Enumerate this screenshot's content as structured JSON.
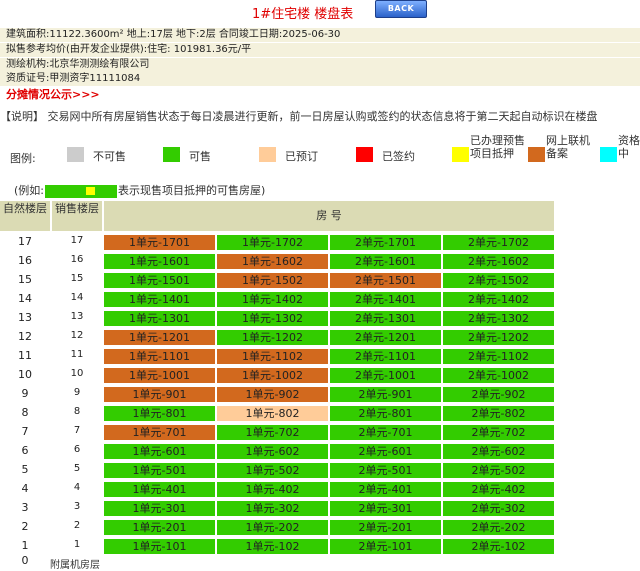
{
  "header": {
    "title": "1#住宅楼  楼盘表",
    "back_label": "BACK"
  },
  "info": {
    "line1": "建筑面积:11122.3600m²   地上:17层   地下:2层   合同竣工日期:2025-06-30",
    "line2": "拟售参考均价(由开发企业提供):住宅:  101981.36元/平",
    "line3": "测绘机构:北京华测测绘有限公司",
    "line4": "资质证号:甲测资字11111084"
  },
  "share_link": "分摊情况公示>>>",
  "notice": "【说明】 交易网中所有房屋销售状态于每日凌晨进行更新，前一日房屋认购或签约的状态信息将于第二天起自动标识在楼盘",
  "legend": {
    "label": "图例:",
    "items": [
      {
        "label": "不可售",
        "color": "#cccccc"
      },
      {
        "label": "可售",
        "color": "#33cc00"
      },
      {
        "label": "已预订",
        "color": "#ffcc99"
      },
      {
        "label": "已签约",
        "color": "#ff0000"
      },
      {
        "label": "已办理预售项目抵押",
        "color": "#ffff00"
      },
      {
        "label": "网上联机备案",
        "color": "#d2691e"
      },
      {
        "label": "资格中",
        "color": "#00ffff"
      }
    ]
  },
  "example": {
    "prefix": "(例如:",
    "suffix": "表示现售项目抵押的可售房屋)"
  },
  "table": {
    "col_natural": "自然楼层",
    "col_sales": "销售楼层",
    "col_room": "房  号",
    "status_colors": {
      "ok": "#33cc00",
      "mortgage": "#d2691e",
      "reserved": "#ffcc99"
    },
    "rows": [
      {
        "natural": "17",
        "sales": "17",
        "units": [
          {
            "label": "1单元-1701",
            "status": "mortgage"
          },
          {
            "label": "1单元-1702",
            "status": "ok"
          },
          {
            "label": "2单元-1701",
            "status": "ok"
          },
          {
            "label": "2单元-1702",
            "status": "ok"
          }
        ]
      },
      {
        "natural": "16",
        "sales": "16",
        "units": [
          {
            "label": "1单元-1601",
            "status": "ok"
          },
          {
            "label": "1单元-1602",
            "status": "mortgage"
          },
          {
            "label": "2单元-1601",
            "status": "ok"
          },
          {
            "label": "2单元-1602",
            "status": "ok"
          }
        ]
      },
      {
        "natural": "15",
        "sales": "15",
        "units": [
          {
            "label": "1单元-1501",
            "status": "ok"
          },
          {
            "label": "1单元-1502",
            "status": "mortgage"
          },
          {
            "label": "2单元-1501",
            "status": "mortgage"
          },
          {
            "label": "2单元-1502",
            "status": "ok"
          }
        ]
      },
      {
        "natural": "14",
        "sales": "14",
        "units": [
          {
            "label": "1单元-1401",
            "status": "ok"
          },
          {
            "label": "1单元-1402",
            "status": "ok"
          },
          {
            "label": "2单元-1401",
            "status": "ok"
          },
          {
            "label": "2单元-1402",
            "status": "ok"
          }
        ]
      },
      {
        "natural": "13",
        "sales": "13",
        "units": [
          {
            "label": "1单元-1301",
            "status": "ok"
          },
          {
            "label": "1单元-1302",
            "status": "ok"
          },
          {
            "label": "2单元-1301",
            "status": "ok"
          },
          {
            "label": "2单元-1302",
            "status": "ok"
          }
        ]
      },
      {
        "natural": "12",
        "sales": "12",
        "units": [
          {
            "label": "1单元-1201",
            "status": "mortgage"
          },
          {
            "label": "1单元-1202",
            "status": "ok"
          },
          {
            "label": "2单元-1201",
            "status": "ok"
          },
          {
            "label": "2单元-1202",
            "status": "ok"
          }
        ]
      },
      {
        "natural": "11",
        "sales": "11",
        "units": [
          {
            "label": "1单元-1101",
            "status": "mortgage"
          },
          {
            "label": "1单元-1102",
            "status": "mortgage"
          },
          {
            "label": "2单元-1101",
            "status": "ok"
          },
          {
            "label": "2单元-1102",
            "status": "ok"
          }
        ]
      },
      {
        "natural": "10",
        "sales": "10",
        "units": [
          {
            "label": "1单元-1001",
            "status": "mortgage"
          },
          {
            "label": "1单元-1002",
            "status": "mortgage"
          },
          {
            "label": "2单元-1001",
            "status": "ok"
          },
          {
            "label": "2单元-1002",
            "status": "ok"
          }
        ]
      },
      {
        "natural": "9",
        "sales": "9",
        "units": [
          {
            "label": "1单元-901",
            "status": "mortgage"
          },
          {
            "label": "1单元-902",
            "status": "mortgage"
          },
          {
            "label": "2单元-901",
            "status": "ok"
          },
          {
            "label": "2单元-902",
            "status": "ok"
          }
        ]
      },
      {
        "natural": "8",
        "sales": "8",
        "units": [
          {
            "label": "1单元-801",
            "status": "ok"
          },
          {
            "label": "1单元-802",
            "status": "reserved"
          },
          {
            "label": "2单元-801",
            "status": "ok"
          },
          {
            "label": "2单元-802",
            "status": "ok"
          }
        ]
      },
      {
        "natural": "7",
        "sales": "7",
        "units": [
          {
            "label": "1单元-701",
            "status": "mortgage"
          },
          {
            "label": "1单元-702",
            "status": "ok"
          },
          {
            "label": "2单元-701",
            "status": "ok"
          },
          {
            "label": "2单元-702",
            "status": "ok"
          }
        ]
      },
      {
        "natural": "6",
        "sales": "6",
        "units": [
          {
            "label": "1单元-601",
            "status": "ok"
          },
          {
            "label": "1单元-602",
            "status": "ok"
          },
          {
            "label": "2单元-601",
            "status": "ok"
          },
          {
            "label": "2单元-602",
            "status": "ok"
          }
        ]
      },
      {
        "natural": "5",
        "sales": "5",
        "units": [
          {
            "label": "1单元-501",
            "status": "ok"
          },
          {
            "label": "1单元-502",
            "status": "ok"
          },
          {
            "label": "2单元-501",
            "status": "ok"
          },
          {
            "label": "2单元-502",
            "status": "ok"
          }
        ]
      },
      {
        "natural": "4",
        "sales": "4",
        "units": [
          {
            "label": "1单元-401",
            "status": "ok"
          },
          {
            "label": "1单元-402",
            "status": "ok"
          },
          {
            "label": "2单元-401",
            "status": "ok"
          },
          {
            "label": "2单元-402",
            "status": "ok"
          }
        ]
      },
      {
        "natural": "3",
        "sales": "3",
        "units": [
          {
            "label": "1单元-301",
            "status": "ok"
          },
          {
            "label": "1单元-302",
            "status": "ok"
          },
          {
            "label": "2单元-301",
            "status": "ok"
          },
          {
            "label": "2单元-302",
            "status": "ok"
          }
        ]
      },
      {
        "natural": "2",
        "sales": "2",
        "units": [
          {
            "label": "1单元-201",
            "status": "ok"
          },
          {
            "label": "1单元-202",
            "status": "ok"
          },
          {
            "label": "2单元-201",
            "status": "ok"
          },
          {
            "label": "2单元-202",
            "status": "ok"
          }
        ]
      },
      {
        "natural": "1",
        "sales": "1",
        "units": [
          {
            "label": "1单元-101",
            "status": "ok"
          },
          {
            "label": "1单元-102",
            "status": "ok"
          },
          {
            "label": "2单元-101",
            "status": "ok"
          },
          {
            "label": "2单元-102",
            "status": "ok"
          }
        ]
      }
    ],
    "bottom_natural": "0",
    "bottom_label": "附属机房层"
  }
}
